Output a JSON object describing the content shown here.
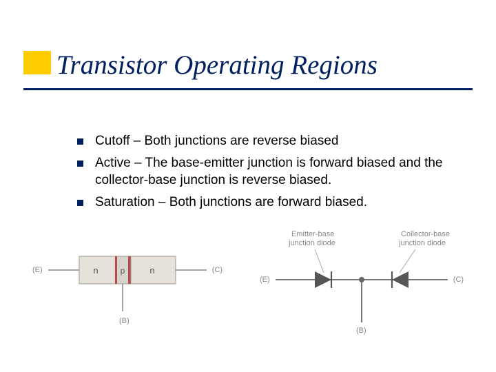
{
  "title": "Transistor Operating Regions",
  "bullets": [
    {
      "term": "Cutoff",
      "text": " – Both junctions are reverse biased"
    },
    {
      "term": "Active",
      "text": " – The base-emitter junction is forward biased and the collector-base junction is reverse biased."
    },
    {
      "term": "Saturation",
      "text": " – Both junctions are forward biased."
    }
  ],
  "fig1": {
    "left_label": "(E)",
    "right_label": "(C)",
    "bottom_label": "(B)",
    "block1": "n",
    "block2": "p",
    "block3": "n"
  },
  "fig2": {
    "top_left": "Emitter-base",
    "top_left2": "junction diode",
    "top_right": "Collector-base",
    "top_right2": "junction diode",
    "left_label": "(E)",
    "right_label": "(C)",
    "bottom_label": "(B)"
  }
}
